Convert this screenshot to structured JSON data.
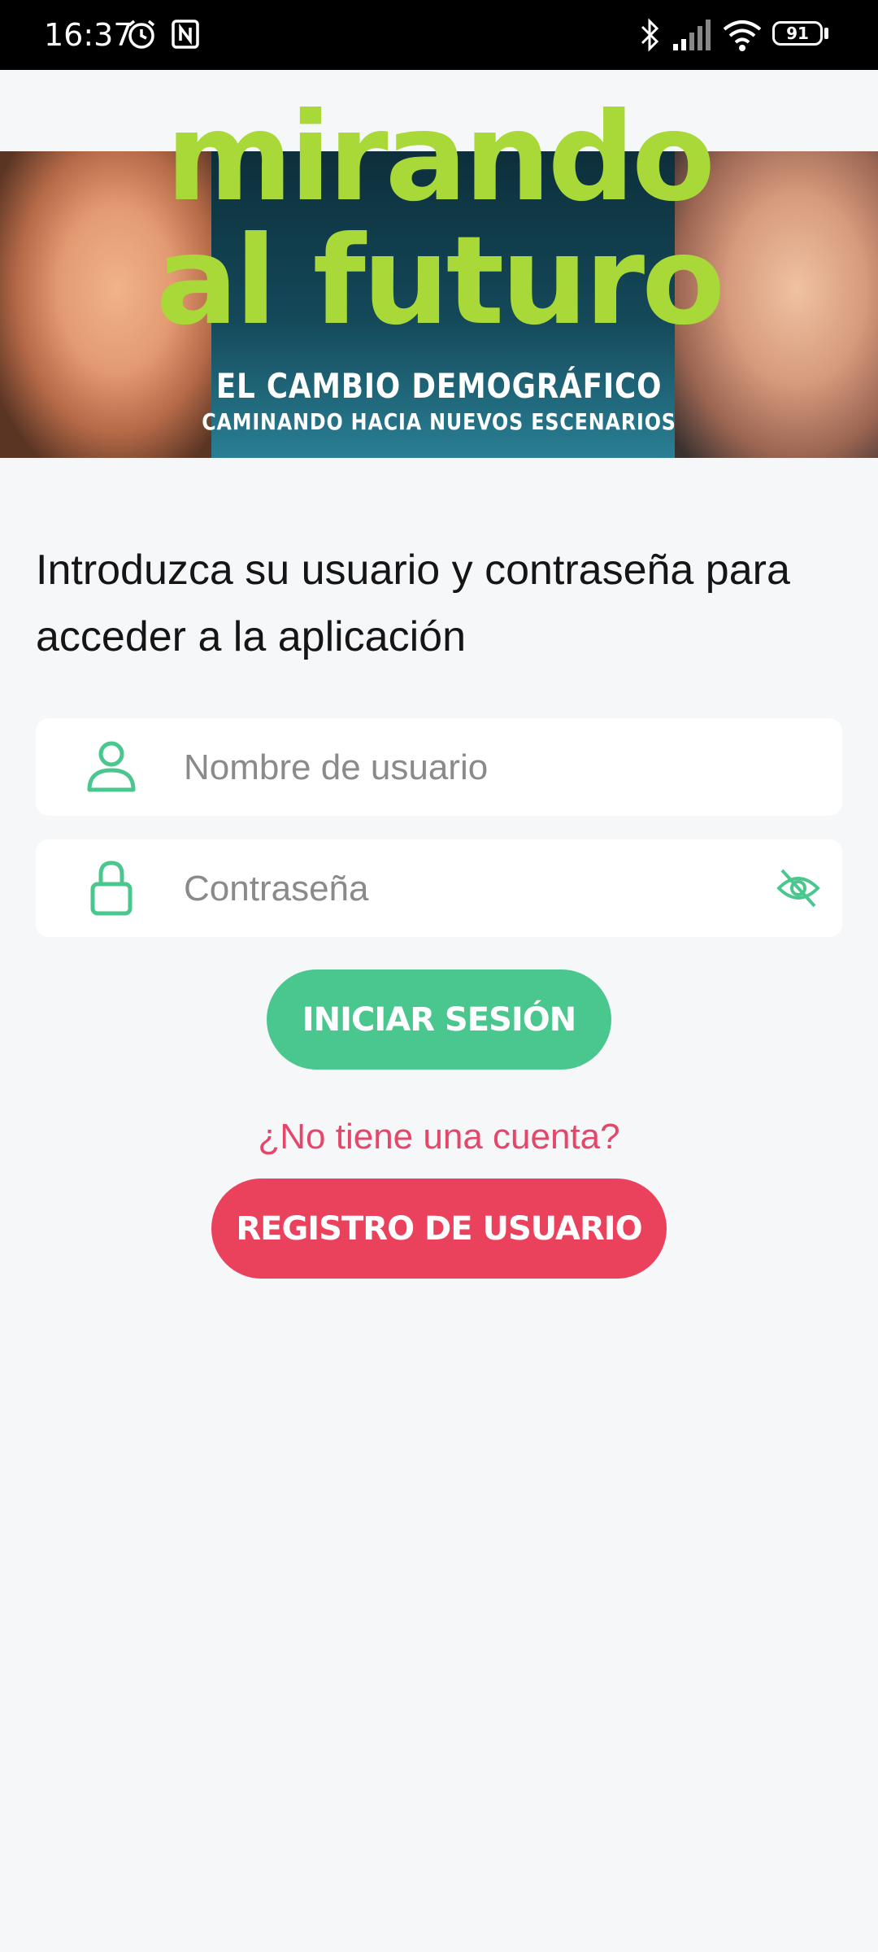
{
  "status_bar": {
    "time": "16:37",
    "battery": "91",
    "icons": [
      "alarm-icon",
      "nfc-icon",
      "bluetooth-icon",
      "signal-icon",
      "wifi-icon",
      "battery-icon"
    ]
  },
  "banner": {
    "title_line1": "mirando",
    "title_line2": "al futuro",
    "subtitle1": "EL CAMBIO DEMOGRÁFICO",
    "subtitle2": "CAMINANDO HACIA NUEVOS ESCENARIOS"
  },
  "login": {
    "instructions": "Introduzca su usuario y contraseña para acceder a la aplicación",
    "username_placeholder": "Nombre de usuario",
    "username_value": "",
    "password_placeholder": "Contraseña",
    "password_value": "",
    "submit_label": "INICIAR SESIÓN"
  },
  "register": {
    "prompt": "¿No tiene una cuenta?",
    "button_label": "REGISTRO DE USUARIO"
  },
  "colors": {
    "accent_green": "#4ac78e",
    "accent_red": "#ea425c",
    "banner_green": "#a8d938",
    "link_red": "#e5476a"
  }
}
